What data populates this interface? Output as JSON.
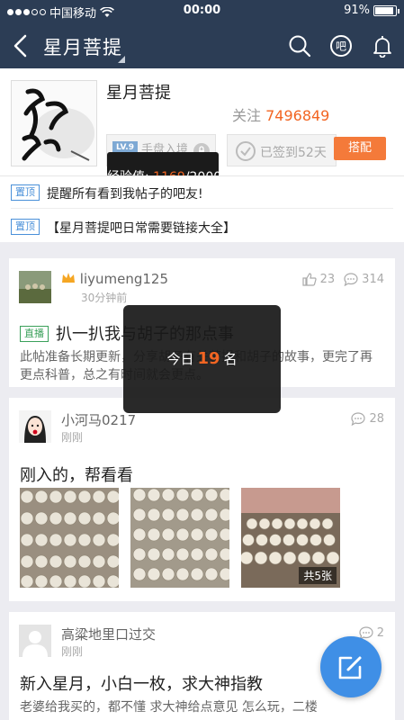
{
  "status_bar": {
    "carrier": "中国移动",
    "time": "00:00",
    "battery": "91%"
  },
  "nav": {
    "title": "星月菩提",
    "icons": [
      "back-icon",
      "search-icon",
      "bar-icon",
      "bell-icon"
    ]
  },
  "header": {
    "bar_name": "星月菩提",
    "members_label": "关注 ",
    "members_count": "7496849",
    "level_badge": "LV.9",
    "level_title": "手盘入境",
    "level_progress": 0.58,
    "sign_label": "已签到52天",
    "match_label": "搭配",
    "tooltip": {
      "prefix": "经验值: ",
      "current": "1169",
      "total": "/2000"
    }
  },
  "pinned": [
    {
      "tag": "置顶",
      "text": "提醒所有看到我帖子的吧友!"
    },
    {
      "tag": "置顶",
      "text": "【星月菩提吧日常需要链接大全】"
    }
  ],
  "posts": [
    {
      "user": "liyumeng125",
      "time": "30分钟前",
      "likes": "23",
      "comments": "314",
      "tag": "直播",
      "title": "扒一扒我与胡子的那点事",
      "body": "此帖准备长期更新，分享胡子有关菩提和胡子的故事，更完了再更点科普，总之有时间就会更点。"
    },
    {
      "user": "小河马0217",
      "time": "刚刚",
      "comments": "28",
      "title": "刚入的，帮看看",
      "image_count": "共5张"
    },
    {
      "user": "高粱地里口过交",
      "time": "刚刚",
      "comments": "2",
      "title": "新入星月，小白一枚，求大神指教",
      "body": "老婆给我买的，都不懂 求大神给点意见 怎么玩，二楼"
    }
  ],
  "toast": {
    "prefix": "今日",
    "rank": "19",
    "suffix": "名"
  },
  "colors": {
    "nav_bg": "#2c3d55",
    "accent": "#f26522",
    "link_blue": "#4a90d9",
    "fab": "#3f8fe6"
  }
}
